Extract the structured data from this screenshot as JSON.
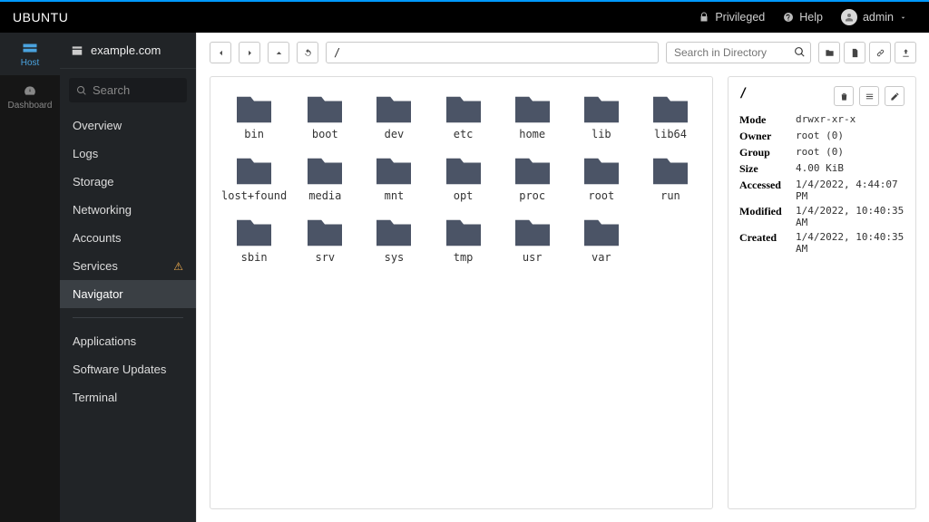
{
  "topbar": {
    "brand": "UBUNTU",
    "privileged": "Privileged",
    "help": "Help",
    "user": "admin"
  },
  "leftrail": {
    "host": "Host",
    "dashboard": "Dashboard"
  },
  "sidemenu": {
    "hostname": "example.com",
    "search_placeholder": "Search",
    "items": [
      {
        "label": "Overview"
      },
      {
        "label": "Logs"
      },
      {
        "label": "Storage"
      },
      {
        "label": "Networking"
      },
      {
        "label": "Accounts"
      },
      {
        "label": "Services",
        "warn": true
      },
      {
        "label": "Navigator",
        "active": true
      }
    ],
    "items2": [
      {
        "label": "Applications"
      },
      {
        "label": "Software Updates"
      },
      {
        "label": "Terminal"
      }
    ]
  },
  "toolbar": {
    "path": "/",
    "search_placeholder": "Search in Directory"
  },
  "folders": [
    "bin",
    "boot",
    "dev",
    "etc",
    "home",
    "lib",
    "lib64",
    "lost+found",
    "media",
    "mnt",
    "opt",
    "proc",
    "root",
    "run",
    "sbin",
    "srv",
    "sys",
    "tmp",
    "usr",
    "var"
  ],
  "details": {
    "title": "/",
    "rows": [
      {
        "k": "Mode",
        "v": "drwxr-xr-x"
      },
      {
        "k": "Owner",
        "v": "root (0)"
      },
      {
        "k": "Group",
        "v": "root (0)"
      },
      {
        "k": "Size",
        "v": "4.00 KiB"
      },
      {
        "k": "Accessed",
        "v": "1/4/2022, 4:44:07 PM"
      },
      {
        "k": "Modified",
        "v": "1/4/2022, 10:40:35 AM"
      },
      {
        "k": "Created",
        "v": "1/4/2022, 10:40:35 AM"
      }
    ]
  }
}
